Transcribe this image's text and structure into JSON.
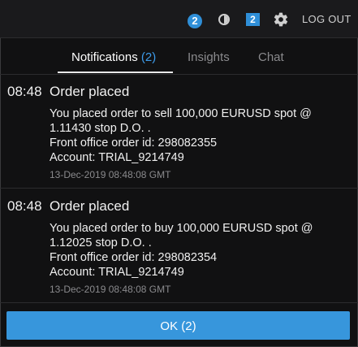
{
  "topbar": {
    "notification_badge": "2",
    "chat_badge": "2",
    "logout_label": "LOG OUT",
    "icons": [
      "contrast-icon",
      "gear-icon"
    ]
  },
  "tabs": [
    {
      "label": "Notifications",
      "count": "(2)",
      "active": true
    },
    {
      "label": "Insights"
    },
    {
      "label": "Chat"
    }
  ],
  "notifications": [
    {
      "time": "08:48",
      "title": "Order placed",
      "lines": [
        "You placed order to sell 100,000 EURUSD spot @",
        "1.11430 stop D.O. .",
        "Front office order id: 298082355",
        "Account: TRIAL_9214749"
      ],
      "timestamp": "13-Dec-2019 08:48:08 GMT"
    },
    {
      "time": "08:48",
      "title": "Order placed",
      "lines": [
        "You placed order to buy 100,000 EURUSD spot @",
        "1.12025 stop D.O. .",
        "Front office order id: 298082354",
        "Account: TRIAL_9214749"
      ],
      "timestamp": "13-Dec-2019 08:48:08 GMT"
    }
  ],
  "ok_button": {
    "label": "OK (2)"
  },
  "colors": {
    "accent": "#3796dc",
    "background": "#111112",
    "muted": "#8a8a8d"
  }
}
